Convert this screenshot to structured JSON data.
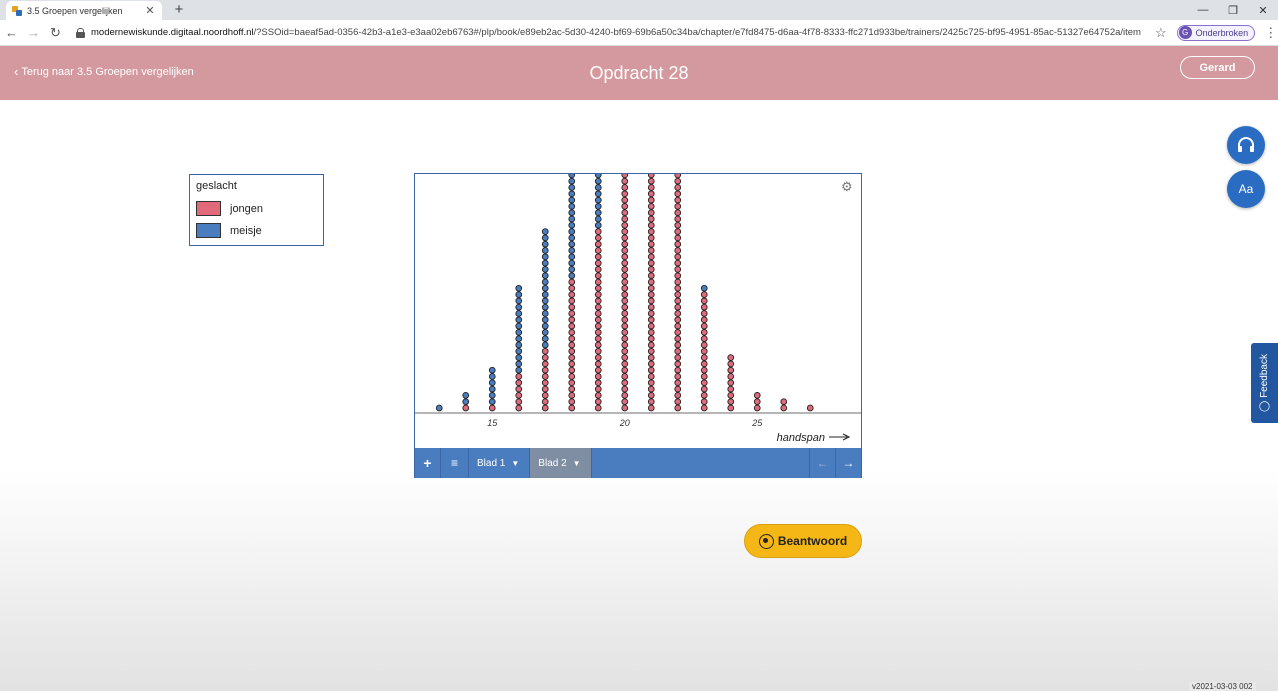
{
  "browser": {
    "tab_title": "3.5 Groepen vergelijken",
    "tab_close": "✕",
    "new_tab": "+",
    "url_host": "modernewiskunde.digitaal.noordhoff.nl",
    "url_path": "/?SSOid=baeaf5ad-0356-42b3-a1e3-e3aa02eb6763#/plp/book/e89eb2ac-5d30-4240-bf69-69b6a50c34ba/chapter/e7fd8475-d6aa-4f78-8333-ffc271d933be/trainers/2425c725-bf95-4951-85ac-51327e64752a/item/...",
    "profile_initial": "G",
    "profile_label": "Onderbroken",
    "icons": [
      "back-arrow-icon",
      "forward-arrow-icon",
      "reload-icon",
      "lock-icon",
      "star-icon",
      "menu-dots-icon"
    ]
  },
  "header": {
    "back_label": "Terug naar 3.5 Groepen vergelijken",
    "title": "Opdracht 28",
    "user_label": "Gerard",
    "background": "#d4999e"
  },
  "side": {
    "font_label": "Aa",
    "feedback_label": "Feedback"
  },
  "legend": {
    "title": "geslacht",
    "items": [
      {
        "label": "jongen",
        "color": "#e0697a"
      },
      {
        "label": "meisje",
        "color": "#4a7cc0"
      }
    ]
  },
  "chart_data": {
    "type": "dotplot",
    "xlabel": "handspan",
    "xlim": [
      12.5,
      26.9
    ],
    "x_ticks": [
      15,
      20,
      25
    ],
    "stacks": [
      {
        "x": 13,
        "meisje": 1,
        "jongen": 0
      },
      {
        "x": 14,
        "meisje": 2,
        "jongen": 1
      },
      {
        "x": 15,
        "meisje": 6,
        "jongen": 1
      },
      {
        "x": 16,
        "meisje": 14,
        "jongen": 6
      },
      {
        "x": 17,
        "meisje": 19,
        "jongen": 10
      },
      {
        "x": 18,
        "meisje": 17,
        "jongen": 21
      },
      {
        "x": 19,
        "meisje": 9,
        "jongen": 29
      },
      {
        "x": 20,
        "meisje": 0,
        "jongen": 38
      },
      {
        "x": 21,
        "meisje": 0,
        "jongen": 38
      },
      {
        "x": 22,
        "meisje": 0,
        "jongen": 38
      },
      {
        "x": 23,
        "meisje": 1,
        "jongen": 19
      },
      {
        "x": 24,
        "meisje": 0,
        "jongen": 9
      },
      {
        "x": 25,
        "meisje": 0,
        "jongen": 3
      },
      {
        "x": 26,
        "meisje": 0,
        "jongen": 2
      },
      {
        "x": 27,
        "meisje": 0,
        "jongen": 1
      }
    ],
    "colors": {
      "jongen": "#e0697a",
      "meisje": "#4a7cc0"
    }
  },
  "panel": {
    "add_label": "+",
    "list_label": "≡",
    "sheets": [
      "Blad 1",
      "Blad 2"
    ],
    "active_sheet": "Blad 2",
    "prev_label": "←",
    "next_label": "→"
  },
  "answer_label": "Beantwoord",
  "version": "v2021-03-03 002"
}
